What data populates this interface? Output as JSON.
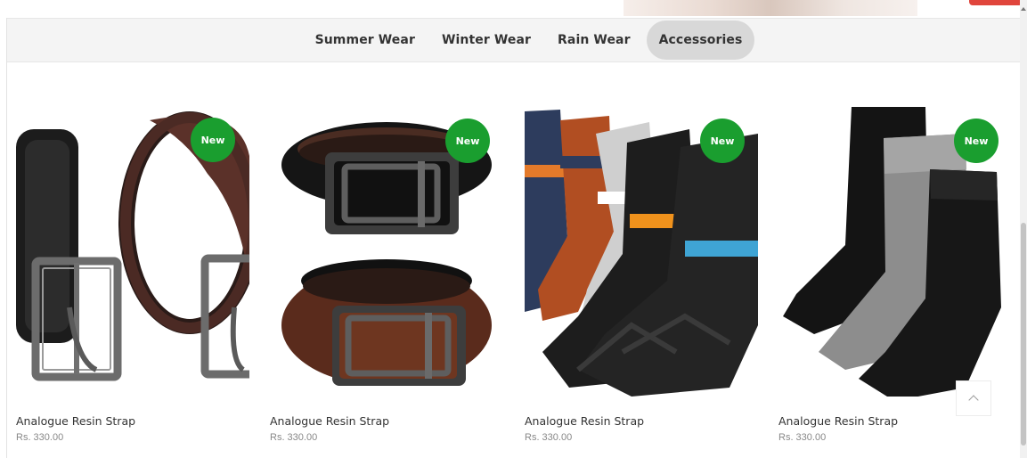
{
  "tabs": [
    {
      "label": "Summer Wear",
      "active": false
    },
    {
      "label": "Winter Wear",
      "active": false
    },
    {
      "label": "Rain Wear",
      "active": false
    },
    {
      "label": "Accessories",
      "active": true
    }
  ],
  "products": [
    {
      "name": "Analogue Resin Strap",
      "price": "Rs. 330.00",
      "badge": "New",
      "image": "belts-black-brown-pair"
    },
    {
      "name": "Analogue Resin Strap",
      "price": "Rs. 330.00",
      "badge": "New",
      "image": "reversible-belts-stacked"
    },
    {
      "name": "Analogue Resin Strap",
      "price": "Rs. 330.00",
      "badge": "New",
      "image": "colorful-sport-socks"
    },
    {
      "name": "Analogue Resin Strap",
      "price": "Rs. 330.00",
      "badge": "New",
      "image": "black-grey-crew-socks"
    }
  ],
  "colors": {
    "badge": "#1a9e2f",
    "tab_active_bg": "#d8d8d8",
    "tabbar_bg": "#f4f4f4"
  },
  "icons": {
    "back_to_top": "chevron-up-icon",
    "scroll_up": "arrow-up-icon"
  }
}
